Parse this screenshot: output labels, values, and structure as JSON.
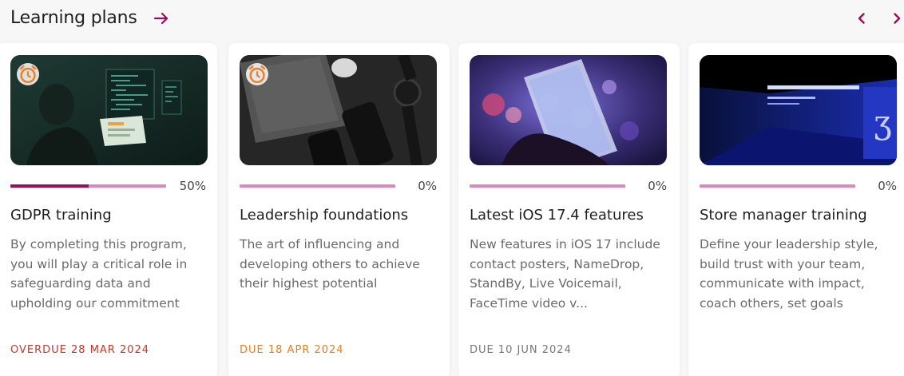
{
  "header": {
    "title": "Learning plans"
  },
  "icons": {
    "title_arrow": "arrow-right-icon",
    "prev": "chevron-left-icon",
    "next": "chevron-right-icon",
    "badge": "alarm-clock-icon"
  },
  "colors": {
    "accent": "#9e0b5c",
    "progress_track": "#d98ab8",
    "overdue": "#c0392b",
    "due_soon": "#e67e22",
    "due_normal": "#777777",
    "badge_icon": "#f07f2a"
  },
  "cards": [
    {
      "title": "GDPR training",
      "progress": 0.5,
      "progress_label": "50%",
      "description": "By completing this program, you will play a critical role in safeguarding data and upholding our commitment",
      "due": "OVERDUE 28 MAR 2024",
      "due_status": "overdue",
      "has_alarm": true
    },
    {
      "title": "Leadership foundations",
      "progress": 0,
      "progress_label": "0%",
      "description": "The art of influencing and developing others to achieve their highest potential",
      "due": "DUE 18 APR 2024",
      "due_status": "soon",
      "has_alarm": true
    },
    {
      "title": "Latest iOS 17.4 features",
      "progress": 0,
      "progress_label": "0%",
      "description": "New features in iOS 17 include contact posters, NameDrop, StandBy, Live Voicemail, FaceTime video v...",
      "due": "DUE 10 JUN 2024",
      "due_status": "normal",
      "has_alarm": false
    },
    {
      "title": "Store manager training",
      "progress": 0,
      "progress_label": "0%",
      "description": "Define your leadership style, build trust with your team, communicate with impact, coach others, set goals",
      "due": "",
      "due_status": "none",
      "has_alarm": false
    }
  ]
}
